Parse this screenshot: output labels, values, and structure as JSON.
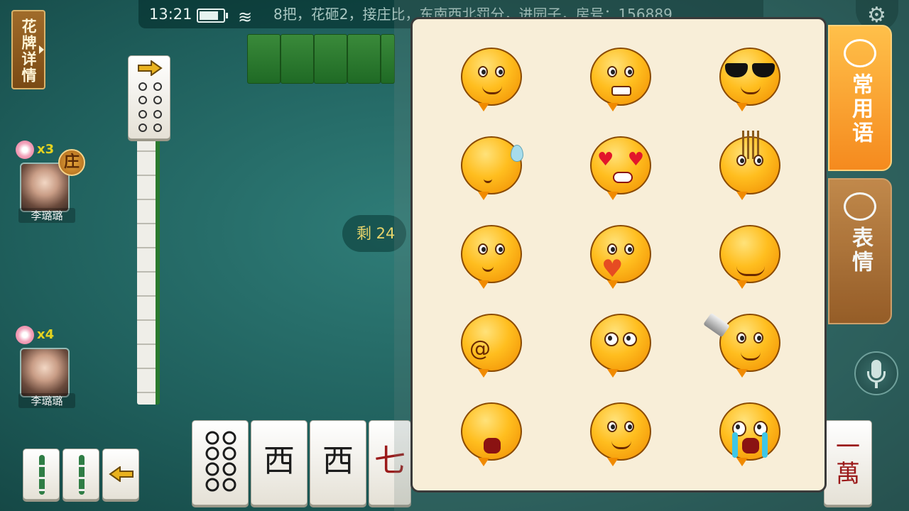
{
  "status_bar": {
    "time": "13:21",
    "game_info": "8把，花砸2，接庄比，东南西北罚分，进园子，房号：156889"
  },
  "hua_pai_button": {
    "label": "花牌详情"
  },
  "players": [
    {
      "name": "李璐璐",
      "flower_count": "x3",
      "is_dealer": true,
      "dealer_badge": "庄"
    },
    {
      "name": "李璐璐",
      "flower_count": "x4",
      "is_dealer": false
    }
  ],
  "table": {
    "remaining_label": "剩 24"
  },
  "hand_tiles": [
    {
      "name": "circle-8",
      "glyph": "●●"
    },
    {
      "name": "west",
      "glyph": "西"
    },
    {
      "name": "west",
      "glyph": "西"
    },
    {
      "name": "wan-7",
      "glyph": "七"
    }
  ],
  "right_edge_tile": {
    "glyph": "一\n萬"
  },
  "emoji_panel": {
    "emojis": [
      "peeking",
      "angry-grit",
      "cool-sunglasses",
      "sweat-sigh",
      "heart-eyes",
      "praying-incense",
      "thumbs-up",
      "broken-heart",
      "smile",
      "dizzy",
      "puppy-eyes",
      "knife-angry",
      "crying-loud",
      "victory",
      "shocked-tears"
    ]
  },
  "side_tabs": [
    {
      "label": "常用语",
      "icon": "chat-bubble-icon",
      "active": true
    },
    {
      "label": "表情",
      "icon": "smiley-icon",
      "active": false
    }
  ],
  "colors": {
    "felt": "#1f5f5c",
    "panel_bg": "#f8eed8",
    "tab_active": "#f58a1e",
    "tab_inactive": "#9b5d25",
    "accent_text": "#e7d46b"
  }
}
